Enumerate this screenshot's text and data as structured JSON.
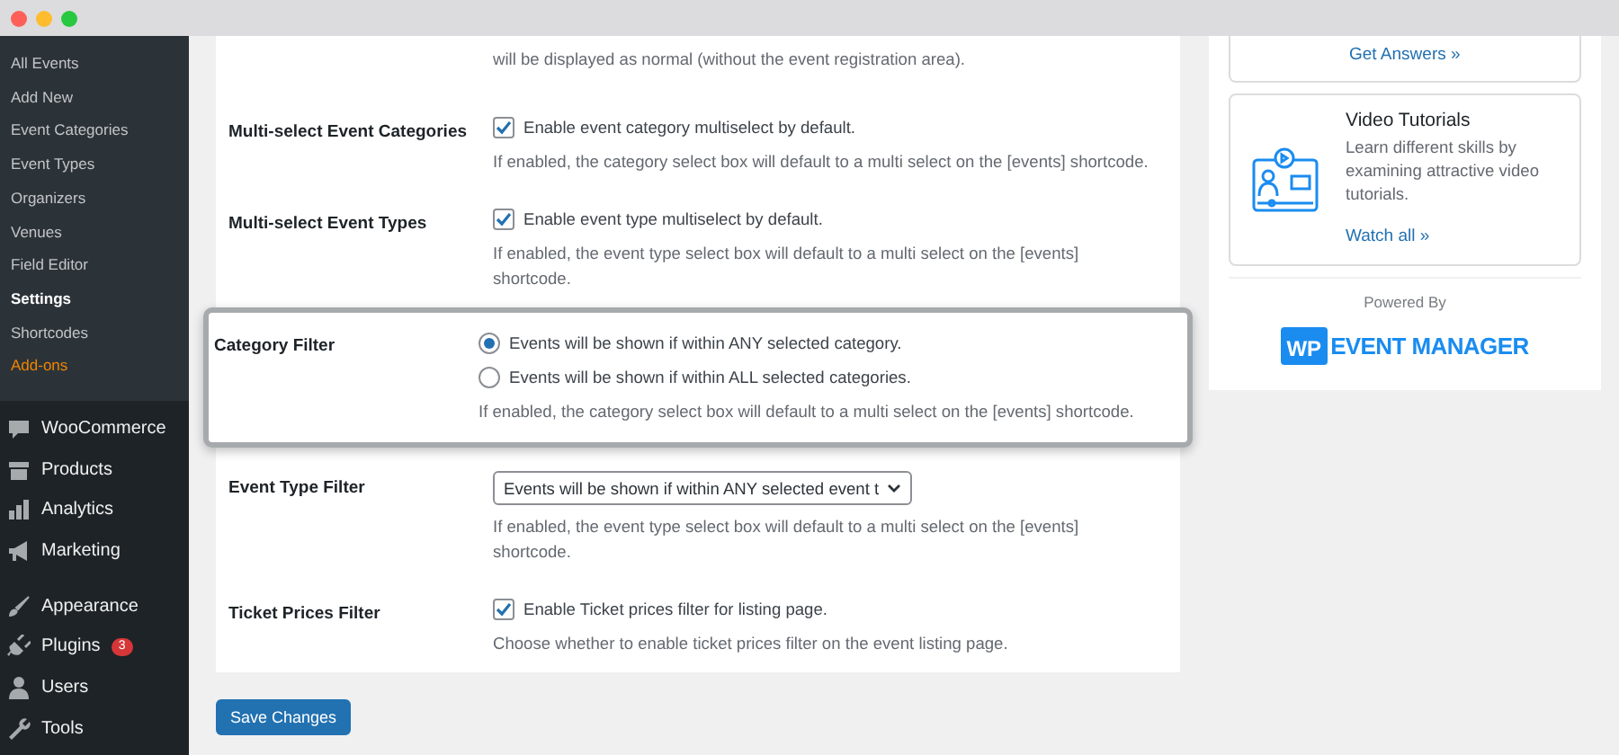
{
  "sidebar": {
    "submenu": [
      {
        "label": "All Events",
        "kind": "item",
        "current": false
      },
      {
        "label": "Add New",
        "kind": "item",
        "current": false
      },
      {
        "label": "Event Categories",
        "kind": "item",
        "current": false
      },
      {
        "label": "Event Types",
        "kind": "item",
        "current": false
      },
      {
        "label": "Organizers",
        "kind": "item",
        "current": false
      },
      {
        "label": "Venues",
        "kind": "item",
        "current": false
      },
      {
        "label": "Field Editor",
        "kind": "item",
        "current": false
      },
      {
        "label": "Settings",
        "kind": "item",
        "current": true
      },
      {
        "label": "Shortcodes",
        "kind": "item",
        "current": false
      },
      {
        "label": "Add-ons",
        "kind": "addon",
        "current": false
      }
    ],
    "menu_groups": [
      [
        {
          "label": "WooCommerce",
          "kind": "woo"
        },
        {
          "label": "Products",
          "kind": "box"
        },
        {
          "label": "Analytics",
          "kind": "bars"
        },
        {
          "label": "Marketing",
          "kind": "megaphone"
        }
      ],
      [
        {
          "label": "Appearance",
          "kind": "brush"
        },
        {
          "label": "Plugins",
          "kind": "plug",
          "badge": "3"
        },
        {
          "label": "Users",
          "kind": "user"
        },
        {
          "label": "Tools",
          "kind": "wrench"
        }
      ]
    ]
  },
  "settings": {
    "intro": "will be displayed as normal (without the event registration area).",
    "rows": [
      {
        "kind": "checkbox",
        "label": "Multi-select Event Categories",
        "option": "Enable event category multiselect by default.",
        "checked": true,
        "description": "If enabled, the category select box will default to a multi select on the [events] shortcode.",
        "highlighted": false
      },
      {
        "kind": "checkbox",
        "label": "Multi-select Event Types",
        "option": "Enable event type multiselect by default.",
        "checked": true,
        "description": "If enabled, the event type select box will default to a multi select on the [events] shortcode.",
        "highlighted": false
      },
      {
        "kind": "radio",
        "label": "Category Filter",
        "options": [
          {
            "label": "Events will be shown if within ANY selected category.",
            "selected": true
          },
          {
            "label": "Events will be shown if within ALL selected categories.",
            "selected": false
          }
        ],
        "description": "If enabled, the category select box will default to a multi select on the [events] shortcode.",
        "highlighted": true
      },
      {
        "kind": "select",
        "label": "Event Type Filter",
        "value": "Events will be shown if within ANY selected event t",
        "description": "If enabled, the event type select box will default to a multi select on the [events] shortcode.",
        "highlighted": false
      },
      {
        "kind": "checkbox",
        "label": "Ticket Prices Filter",
        "option": "Enable Ticket prices filter for listing page.",
        "checked": true,
        "description": "Choose whether to enable ticket prices filter on the event listing page.",
        "highlighted": false
      }
    ]
  },
  "save_button": "Save Changes",
  "side_cards": [
    {
      "link": "Get Answers »"
    },
    {
      "title": "Video Tutorials",
      "text": "Learn different skills by examining attractive video tutorials.",
      "link": "Watch all »"
    }
  ],
  "powered_by": "Powered By",
  "logo": {
    "badge": "WP",
    "text": "EVENT MANAGER"
  }
}
